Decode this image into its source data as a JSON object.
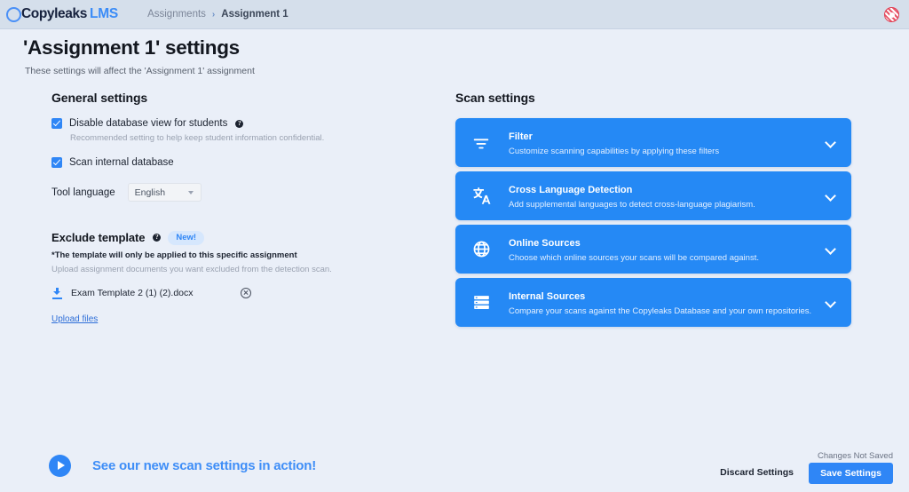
{
  "header": {
    "logo_name": "Copyleaks",
    "logo_suffix": "LMS",
    "breadcrumb": {
      "parent": "Assignments",
      "separator": "›",
      "current": "Assignment 1"
    }
  },
  "page": {
    "title": "'Assignment 1' settings",
    "subtitle": "These settings will affect the 'Assignment 1' assignment"
  },
  "general_settings": {
    "title": "General settings",
    "options": [
      {
        "label": "Disable database view for students",
        "checked": true,
        "has_help": true,
        "hint": "Recommended setting to help keep student information confidential."
      },
      {
        "label": "Scan internal database",
        "checked": true,
        "has_help": false,
        "hint": ""
      }
    ],
    "tool_language": {
      "label": "Tool language",
      "value": "English"
    }
  },
  "exclude_template": {
    "title": "Exclude template",
    "badge": "New!",
    "note": "*The template will only be applied to this specific assignment",
    "description": "Upload assignment documents you want excluded from the detection scan.",
    "file": {
      "name": "Exam Template 2 (1) (2).docx",
      "download_icon": "download-icon",
      "remove_icon": "remove-circle-icon"
    },
    "upload_link": "Upload files"
  },
  "scan_settings": {
    "title": "Scan settings",
    "cards": [
      {
        "icon": "filter-icon",
        "title": "Filter",
        "description": "Customize scanning capabilities by applying these filters",
        "expanded": false
      },
      {
        "icon": "translate-icon",
        "title": "Cross Language Detection",
        "description": "Add supplemental languages to detect cross-language plagiarism.",
        "expanded": false
      },
      {
        "icon": "globe-icon",
        "title": "Online Sources",
        "description": "Choose which online sources your scans will be compared against.",
        "expanded": false
      },
      {
        "icon": "database-icon",
        "title": "Internal Sources",
        "description": "Compare your scans against the Copyleaks Database and your own repositories.",
        "expanded": false
      }
    ]
  },
  "footer": {
    "video_link": "See our new scan settings in action!",
    "play_icon": "play-icon",
    "changes_status": "Changes Not Saved",
    "discard_label": "Discard Settings",
    "save_label": "Save Settings"
  },
  "colors": {
    "accent_blue": "#2f86f6",
    "card_blue": "#2589f5",
    "page_bg": "#eaeff8",
    "topbar_bg": "#d5dfeb",
    "badge_bg": "#d6e7fd",
    "avatar_red": "#e03b50"
  }
}
